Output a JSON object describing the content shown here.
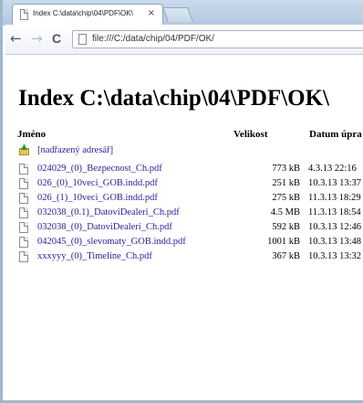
{
  "browser": {
    "tab_title": "Index C:\\data\\chip\\04\\PDF\\OK\\",
    "tab_close": "×",
    "url": "file:///C:/data/chip/04/PDF/OK/"
  },
  "page": {
    "heading": "Index C:\\data\\chip\\04\\PDF\\OK\\",
    "columns": {
      "name": "Jméno",
      "size": "Velikost",
      "date": "Datum úpra"
    },
    "parent_link": "[nadřazený adresář]",
    "files": [
      {
        "name": "024029_(0)_Bezpecnost_Ch.pdf",
        "size": "773 kB",
        "date": "4.3.13 22:16"
      },
      {
        "name": "026_(0)_10veci_GOB.indd.pdf",
        "size": "251 kB",
        "date": "10.3.13 13:37"
      },
      {
        "name": "026_(1)_10veci_GOB.indd.pdf",
        "size": "275 kB",
        "date": "11.3.13 18:29"
      },
      {
        "name": "032038_(0.1)_DatoviDealeri_Ch.pdf",
        "size": "4.5 MB",
        "date": "11.3.13 18:54"
      },
      {
        "name": "032038_(0)_DatoviDealeri_Ch.pdf",
        "size": "592 kB",
        "date": "10.3.13 12:46"
      },
      {
        "name": "042045_(0)_slevomaty_GOB.indd.pdf",
        "size": "1001 kB",
        "date": "10.3.13 13:48"
      },
      {
        "name": "xxxyyy_(0)_Timeline_Ch.pdf",
        "size": "367 kB",
        "date": "10.3.13 13:32"
      }
    ]
  },
  "icons": {
    "tab_icon": "page-icon",
    "back": "back-arrow-icon",
    "forward": "forward-arrow-icon",
    "reload": "reload-icon",
    "file": "file-icon",
    "parent": "folder-up-icon"
  },
  "colors": {
    "link": "#2a1b9a",
    "chrome": "#b3c9e0"
  }
}
